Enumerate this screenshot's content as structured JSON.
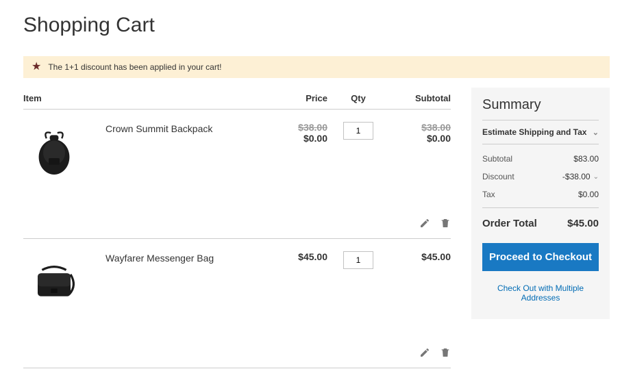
{
  "title": "Shopping Cart",
  "banner": {
    "icon": "star-icon",
    "text": "The 1+1 discount has been applied in your cart!"
  },
  "cart": {
    "columns": {
      "item": "Item",
      "price": "Price",
      "qty": "Qty",
      "subtotal": "Subtotal"
    },
    "items": [
      {
        "name": "Crown Summit Backpack",
        "price_original": "$38.00",
        "price_final": "$0.00",
        "qty": "1",
        "subtotal_original": "$38.00",
        "subtotal_final": "$0.00",
        "image": "backpack"
      },
      {
        "name": "Wayfarer Messenger Bag",
        "price_original": "",
        "price_final": "$45.00",
        "qty": "1",
        "subtotal_original": "",
        "subtotal_final": "$45.00",
        "image": "messenger"
      }
    ]
  },
  "summary": {
    "title": "Summary",
    "estimate_label": "Estimate Shipping and Tax",
    "lines": {
      "subtotal_label": "Subtotal",
      "subtotal_value": "$83.00",
      "discount_label": "Discount",
      "discount_value": "-$38.00",
      "tax_label": "Tax",
      "tax_value": "$0.00"
    },
    "order_total_label": "Order Total",
    "order_total_value": "$45.00",
    "checkout_label": "Proceed to Checkout",
    "multi_address_label": "Check Out with Multiple Addresses"
  }
}
